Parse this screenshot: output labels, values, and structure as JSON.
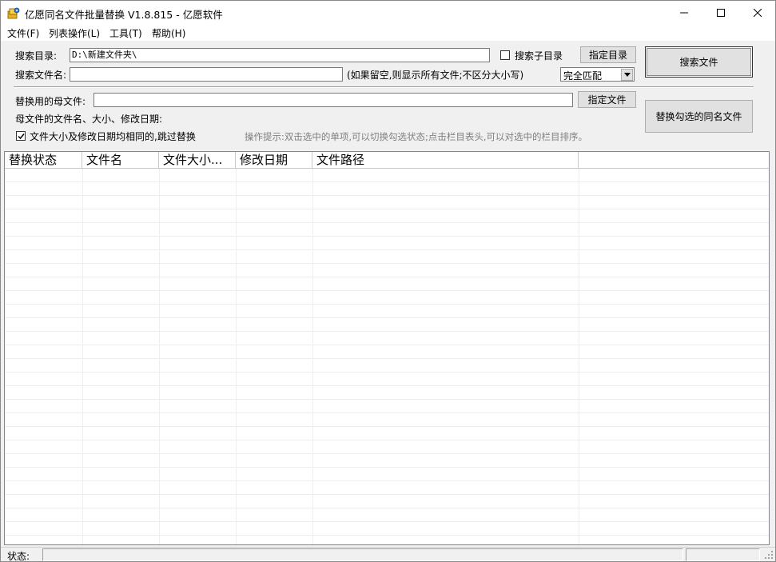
{
  "window": {
    "title": "亿愿同名文件批量替换 V1.8.815 - 亿愿软件",
    "app_icon": "folder-gear-icon",
    "minimize_icon": "minimize-icon",
    "maximize_icon": "maximize-icon",
    "close_icon": "close-icon"
  },
  "menu": {
    "items": [
      "文件(F)",
      "列表操作(L)",
      "工具(T)",
      "帮助(H)"
    ]
  },
  "search": {
    "dir_label": "搜索目录:",
    "dir_value": "D:\\新建文件夹\\",
    "subdir_label": "搜索子目录",
    "subdir_checked": false,
    "choose_dir_button": "指定目录",
    "search_button": "搜索文件",
    "filename_label": "搜索文件名:",
    "filename_value": "",
    "filename_hint": "(如果留空,则显示所有文件;不区分大小写)",
    "match_mode": "完全匹配"
  },
  "replace": {
    "mother_label": "替换用的母文件:",
    "mother_value": "",
    "choose_file_button": "指定文件",
    "mother_info_label": "母文件的文件名、大小、修改日期:",
    "skip_label": "文件大小及修改日期均相同的,跳过替换",
    "skip_checked": true,
    "replace_button": "替换勾选的同名文件",
    "operation_hint": "操作提示:双击选中的单项,可以切换勾选状态;点击栏目表头,可以对选中的栏目排序。"
  },
  "list": {
    "columns": [
      "替换状态",
      "文件名",
      "文件大小...",
      "修改日期",
      "文件路径"
    ]
  },
  "status": {
    "label": "状态:",
    "text": ""
  }
}
